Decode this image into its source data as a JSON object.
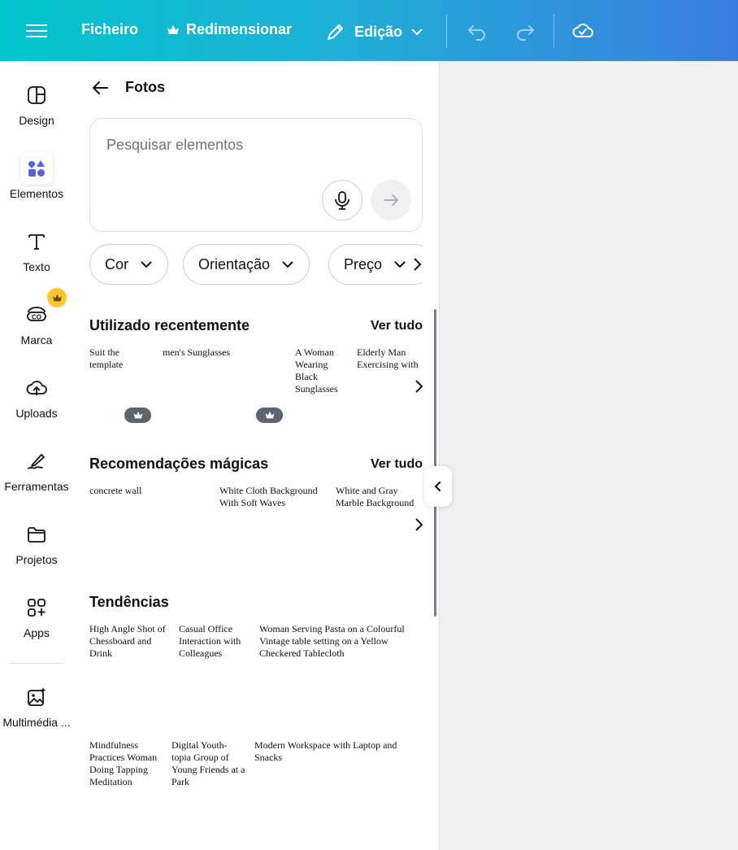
{
  "topbar": {
    "file_label": "Ficheiro",
    "resize_label": "Redimensionar",
    "edit_label": "Edição"
  },
  "rail": {
    "items": [
      {
        "label": "Design",
        "icon": "layout-icon"
      },
      {
        "label": "Elementos",
        "icon": "shapes-icon"
      },
      {
        "label": "Texto",
        "icon": "text-icon"
      },
      {
        "label": "Marca",
        "icon": "brand-icon"
      },
      {
        "label": "Uploads",
        "icon": "cloud-upload-icon"
      },
      {
        "label": "Ferramentas",
        "icon": "draw-icon"
      },
      {
        "label": "Projetos",
        "icon": "folder-icon"
      },
      {
        "label": "Apps",
        "icon": "apps-icon"
      },
      {
        "label": "Multimédia ...",
        "icon": "magic-media-icon"
      }
    ]
  },
  "panel": {
    "title": "Fotos",
    "search_placeholder": "Pesquisar elementos",
    "filters": [
      "Cor",
      "Orientação",
      "Preço"
    ],
    "recent": {
      "title": "Utilizado recentemente",
      "link": "Ver tudo",
      "items": [
        "Suit the template",
        "men's Sunglasses",
        "A Woman Wearing Black Sunglasses",
        "Elderly Man Exercising with Dumbbells at Home"
      ]
    },
    "magic": {
      "title": "Recomendações mágicas",
      "link": "Ver tudo",
      "items": [
        "concrete wall",
        "White Cloth Background With Soft Waves",
        "White and Gray Marble Background"
      ]
    },
    "trends": {
      "title": "Tendências",
      "items": [
        "High Angle Shot of Chessboard and Drink",
        "Casual Office Interaction with Colleagues",
        "Woman Serving Pasta on a Colourful Vintage table setting on a Yellow Checkered Tablecloth",
        "Mindfulness Practices Woman Doing Tapping Meditation",
        "Digital Youth-topia Group of Young Friends at a Park",
        "Modern Workspace with Laptop and Snacks"
      ]
    }
  },
  "colors": {
    "topbar_start": "#00c4cc",
    "topbar_end": "#3a7de0",
    "accent": "#5b5fe0",
    "crown": "#ffc72c"
  }
}
